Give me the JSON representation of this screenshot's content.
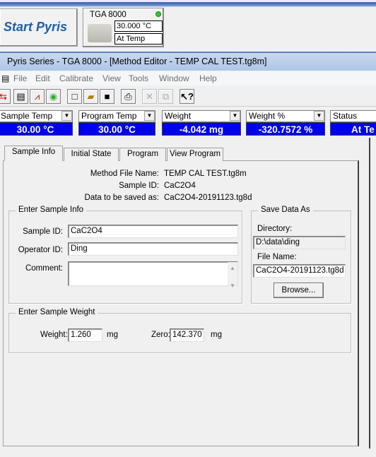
{
  "start_button": {
    "label": "Start Pyris"
  },
  "instrument": {
    "name": "TGA 8000",
    "temperature": "30.000 °C",
    "status": "At Temp",
    "status_color": "#2ecc2e"
  },
  "window": {
    "title": "Pyris Series - TGA 8000 - [Method Editor - TEMP CAL  TEST.tg8m]"
  },
  "menu": [
    "File",
    "Edit",
    "Calibrate",
    "View",
    "Tools",
    "Window",
    "Help"
  ],
  "toolbar": [
    "monitor-icon",
    "document-icon",
    "graph-icon",
    "disc-icon",
    "new-file-icon",
    "open-folder-icon",
    "save-icon",
    "print-icon",
    "delete-icon",
    "copy-icon",
    "help-pointer-icon"
  ],
  "readouts": [
    {
      "label": "Sample Temp",
      "value": "30.00 °C"
    },
    {
      "label": "Program Temp",
      "value": "30.00 °C"
    },
    {
      "label": "Weight",
      "value": "-4.042 mg"
    },
    {
      "label": "Weight %",
      "value": "-320.7572 %"
    },
    {
      "label": "Status",
      "value": "At Te"
    }
  ],
  "readout_color": "#0000f0",
  "tabs": [
    "Sample Info",
    "Initial State",
    "Program",
    "View Program"
  ],
  "active_tab": "Sample Info",
  "summary": {
    "method_label": "Method File Name:",
    "method_value": "TEMP CAL  TEST.tg8m",
    "sample_label": "Sample ID:",
    "sample_value": "CaC2O4",
    "data_label": "Data to be saved as:",
    "data_value": "CaC2O4-20191123.tg8d"
  },
  "sample_info": {
    "title": "Enter Sample Info",
    "sample_id_label": "Sample ID:",
    "sample_id": "CaC2O4",
    "operator_label": "Operator ID:",
    "operator": "Ding",
    "comment_label": "Comment:",
    "comment": ""
  },
  "save_data": {
    "title": "Save Data As",
    "directory_label": "Directory:",
    "directory": "D:\\data\\ding",
    "file_label": "File Name:",
    "file": "CaC2O4-20191123.tg8d",
    "browse": "Browse..."
  },
  "sample_weight": {
    "title": "Enter Sample Weight",
    "weight_label": "Weight:",
    "weight": "1.260",
    "weight_unit": "mg",
    "zero_label": "Zero:",
    "zero": "142.370",
    "zero_unit": "mg"
  }
}
